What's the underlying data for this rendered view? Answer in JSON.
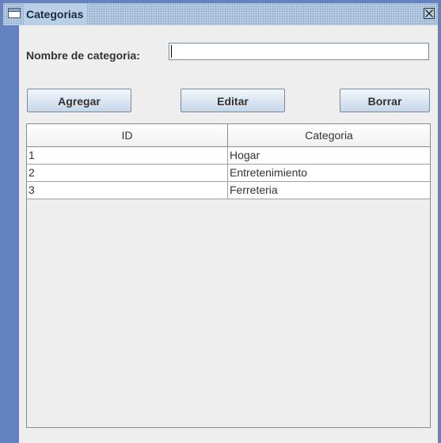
{
  "window": {
    "title": "Categorias",
    "icon": "window-icon",
    "close_icon": "close-icon"
  },
  "form": {
    "name_label": "Nombre de categoria:",
    "name_value": "",
    "name_placeholder": ""
  },
  "buttons": {
    "add_label": "Agregar",
    "edit_label": "Editar",
    "delete_label": "Borrar"
  },
  "table": {
    "columns": [
      "ID",
      "Categoria"
    ],
    "rows": [
      {
        "id": "1",
        "categoria": "Hogar"
      },
      {
        "id": "2",
        "categoria": "Entretenimiento"
      },
      {
        "id": "3",
        "categoria": "Ferreteria"
      }
    ]
  },
  "colors": {
    "frame_border": "#6382bf",
    "titlebar": "#b9cfe5",
    "content_bg": "#eeeeee",
    "grid_line": "#8aa4c8"
  }
}
